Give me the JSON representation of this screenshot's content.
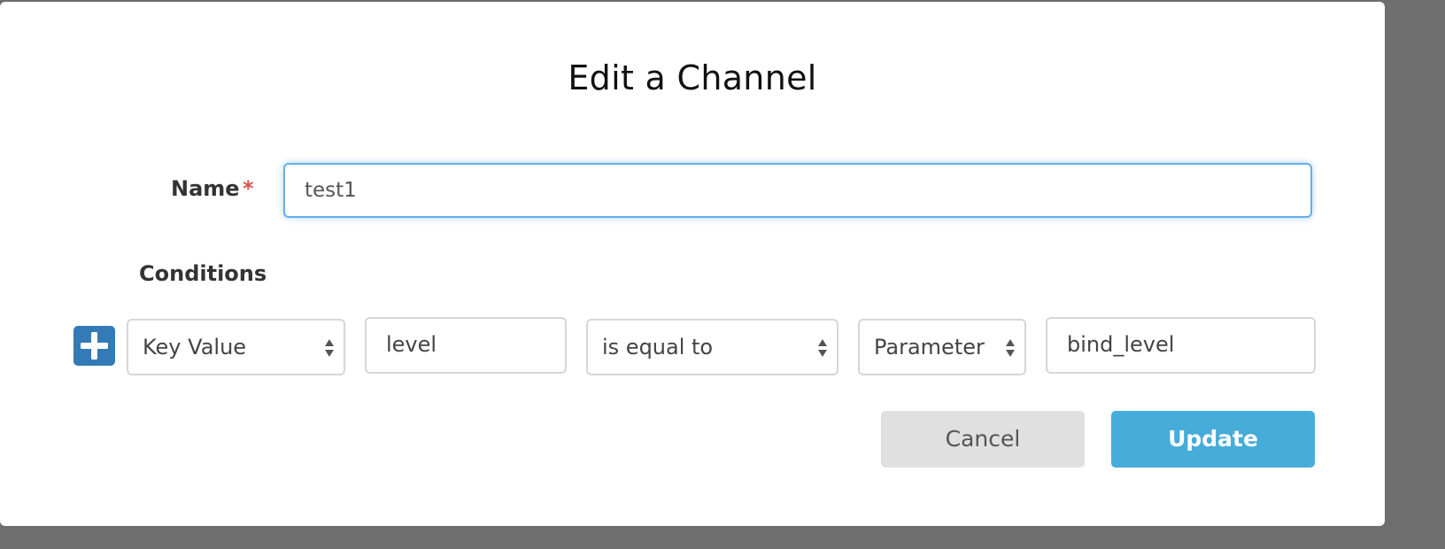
{
  "dialog": {
    "title": "Edit a Channel"
  },
  "form": {
    "name_label": "Name",
    "required_marker": "*",
    "name_value": "test1",
    "conditions_label": "Conditions"
  },
  "condition_row": {
    "add_icon": "plus-icon",
    "type_select": "Key Value",
    "key_input": "level",
    "operator_select": "is equal to",
    "value_type_select": "Parameter",
    "value_input": "bind_level"
  },
  "actions": {
    "cancel_label": "Cancel",
    "update_label": "Update"
  },
  "colors": {
    "accent": "#46acd9",
    "add_button": "#337ab7",
    "required": "#d9534f",
    "focus_border": "#66afe9"
  }
}
